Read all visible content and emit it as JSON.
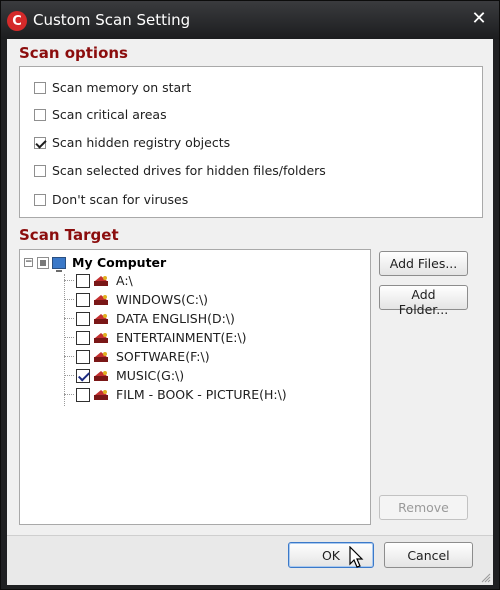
{
  "window": {
    "title": "Custom Scan Setting",
    "logo_letter": "C",
    "close_label": "✕"
  },
  "scan_options": {
    "heading": "Scan options",
    "items": [
      {
        "label": "Scan memory on start",
        "checked": false
      },
      {
        "label": "Scan critical areas",
        "checked": false
      },
      {
        "label": "Scan hidden registry objects",
        "checked": true
      },
      {
        "label": "Scan selected drives for hidden files/folders",
        "checked": false
      },
      {
        "label": "Don't scan for viruses",
        "checked": false
      }
    ]
  },
  "scan_target": {
    "heading": "Scan Target",
    "root_label": "My Computer",
    "root_expander": "−",
    "drives": [
      {
        "label": "A:\\",
        "checked": false
      },
      {
        "label": "WINDOWS(C:\\)",
        "checked": false
      },
      {
        "label": "DATA ENGLISH(D:\\)",
        "checked": false
      },
      {
        "label": "ENTERTAINMENT(E:\\)",
        "checked": false
      },
      {
        "label": "SOFTWARE(F:\\)",
        "checked": false
      },
      {
        "label": "MUSIC(G:\\)",
        "checked": true
      },
      {
        "label": "FILM - BOOK - PICTURE(H:\\)",
        "checked": false
      }
    ]
  },
  "buttons": {
    "add_files": "Add Files...",
    "add_folder": "Add Folder...",
    "remove": "Remove",
    "ok": "OK",
    "cancel": "Cancel"
  },
  "colors": {
    "heading_red": "#8b0d0d",
    "title_bar": "#1f2022",
    "logo_red": "#d42a2a"
  }
}
